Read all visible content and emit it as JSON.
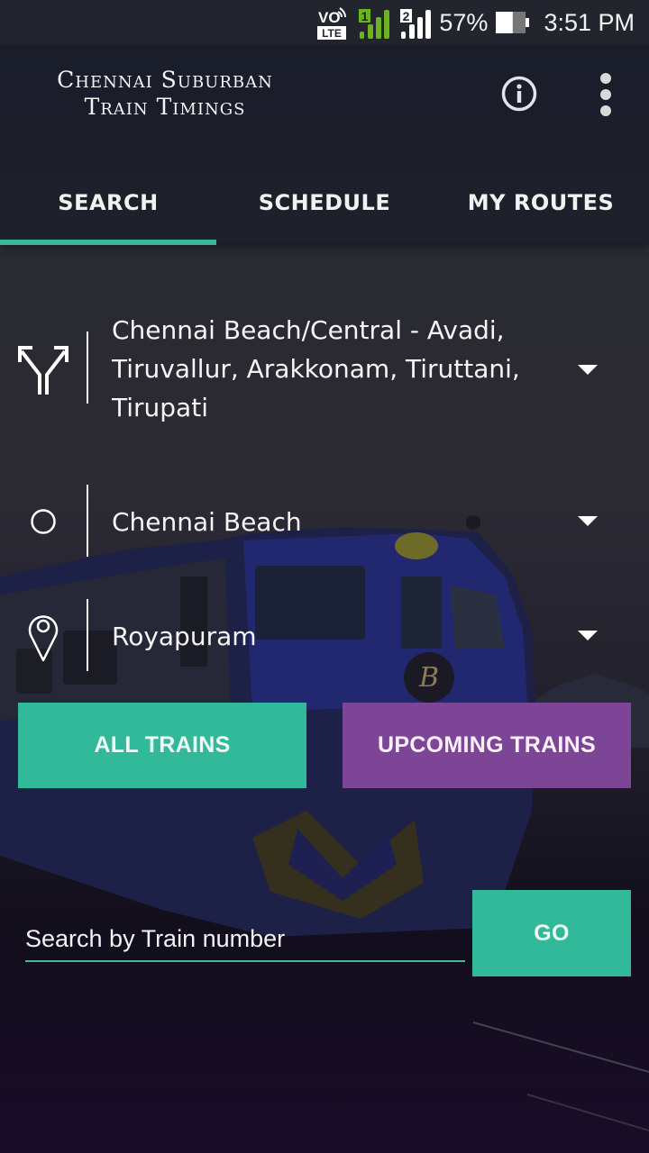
{
  "status_bar": {
    "volte_label": "VO",
    "lte_label": "LTE",
    "sim1_label": "1",
    "sim2_label": "2",
    "battery_percent": "57%",
    "battery_level": 0.57,
    "time": "3:51 PM",
    "icons": [
      "volte-icon",
      "sim1-signal-icon",
      "sim2-signal-icon",
      "battery-icon"
    ]
  },
  "app_bar": {
    "title_line1": "Chennai Suburban",
    "title_line2": "Train Timings",
    "info_icon": "info-icon",
    "menu_icon": "more-vert-icon"
  },
  "tabs": [
    {
      "label": "SEARCH",
      "active": true
    },
    {
      "label": "SCHEDULE",
      "active": false
    },
    {
      "label": "MY ROUTES",
      "active": false
    }
  ],
  "form": {
    "route": {
      "icon": "route-split-icon",
      "value": "Chennai Beach/Central - Avadi, Tiruvallur, Arakkonam, Tiruttani, Tirupati"
    },
    "from_station": {
      "icon": "origin-circle-icon",
      "value": "Chennai Beach"
    },
    "to_station": {
      "icon": "location-pin-icon",
      "value": "Royapuram"
    }
  },
  "buttons": {
    "all_trains": "ALL TRAINS",
    "upcoming_trains": "UPCOMING TRAINS",
    "go": "GO"
  },
  "search": {
    "placeholder": "Search by Train number",
    "value": ""
  },
  "colors": {
    "accent_teal": "#31b999",
    "accent_purple": "#7d4595",
    "app_bar": "#1c1f2b"
  }
}
